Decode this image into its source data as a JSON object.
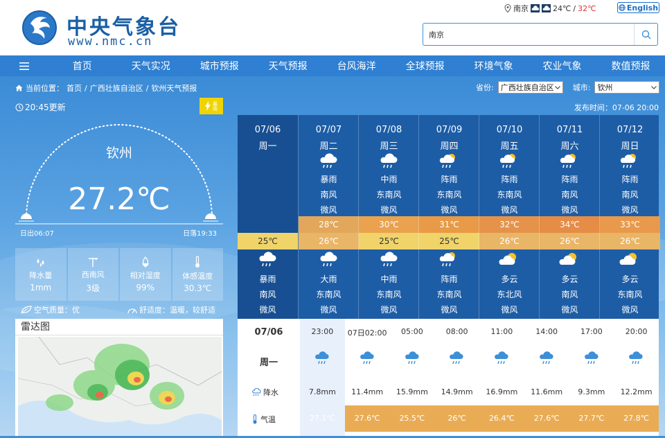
{
  "header": {
    "site_name": "中央气象台",
    "site_url": "www.nmc.cn",
    "location": "南京",
    "temp_low": "24℃",
    "temp_sep": "/",
    "temp_high": "32℃",
    "lang_button": "English",
    "search_value": "南京"
  },
  "nav": {
    "items": [
      "首页",
      "天气实况",
      "城市预报",
      "天气预报",
      "台风海洋",
      "全球预报",
      "环境气象",
      "农业气象",
      "数值预报"
    ]
  },
  "breadcrumb": {
    "prefix": "当前位置：",
    "home": "首页",
    "sep1": "/",
    "region": "广西壮族自治区",
    "sep2": "/",
    "page": "钦州天气预报"
  },
  "selector": {
    "province_label": "省份:",
    "province_value": "广西壮族自治区",
    "city_label": "城市:",
    "city_value": "钦州"
  },
  "current": {
    "update_time": "20:45更新",
    "warning_text": "暴雨",
    "city": "钦州",
    "temperature": "27.2℃",
    "sunrise": "日出06:07",
    "sunset": "日落19:33",
    "publish_time": "发布时间：07-06 20:00",
    "stats": [
      {
        "label": "降水量",
        "value": "1mm",
        "icon": "raindrops-icon"
      },
      {
        "label": "西南风",
        "value": "3级",
        "icon": "wind-icon"
      },
      {
        "label": "相对湿度",
        "value": "99%",
        "icon": "humidity-icon"
      },
      {
        "label": "体感温度",
        "value": "30.3℃",
        "icon": "thermometer-icon"
      }
    ],
    "air_quality": "空气质量：优",
    "comfort": "舒适度：温暖，较舒适"
  },
  "radar": {
    "title": "雷达图"
  },
  "forecast": [
    {
      "date": "07/06",
      "weekday": "周一",
      "day_weather": "",
      "day_wind_dir": "",
      "day_wind": "",
      "high": "",
      "low": "25℃",
      "night_weather": "暴雨",
      "night_wind_dir": "南风",
      "night_wind": "微风",
      "day_icon": "",
      "night_icon": "rain-cloud-icon"
    },
    {
      "date": "07/07",
      "weekday": "周二",
      "day_weather": "暴雨",
      "day_wind_dir": "南风",
      "day_wind": "微风",
      "high": "28℃",
      "low": "26℃",
      "night_weather": "大雨",
      "night_wind_dir": "东南风",
      "night_wind": "微风",
      "day_icon": "rain-cloud-icon",
      "night_icon": "rain-cloud-icon"
    },
    {
      "date": "07/08",
      "weekday": "周三",
      "day_weather": "中雨",
      "day_wind_dir": "东南风",
      "day_wind": "微风",
      "high": "30℃",
      "low": "25℃",
      "night_weather": "中雨",
      "night_wind_dir": "东南风",
      "night_wind": "微风",
      "day_icon": "rain-cloud-icon",
      "night_icon": "rain-cloud-icon"
    },
    {
      "date": "07/09",
      "weekday": "周四",
      "day_weather": "阵雨",
      "day_wind_dir": "东南风",
      "day_wind": "微风",
      "high": "31℃",
      "low": "25℃",
      "night_weather": "阵雨",
      "night_wind_dir": "东南风",
      "night_wind": "微风",
      "day_icon": "sun-shower-icon",
      "night_icon": "sun-shower-icon"
    },
    {
      "date": "07/10",
      "weekday": "周五",
      "day_weather": "阵雨",
      "day_wind_dir": "东南风",
      "day_wind": "微风",
      "high": "32℃",
      "low": "26℃",
      "night_weather": "多云",
      "night_wind_dir": "东北风",
      "night_wind": "微风",
      "day_icon": "sun-shower-icon",
      "night_icon": "partly-cloudy-icon"
    },
    {
      "date": "07/11",
      "weekday": "周六",
      "day_weather": "阵雨",
      "day_wind_dir": "南风",
      "day_wind": "微风",
      "high": "34℃",
      "low": "26℃",
      "night_weather": "多云",
      "night_wind_dir": "南风",
      "night_wind": "微风",
      "day_icon": "sun-shower-icon",
      "night_icon": "partly-cloudy-icon"
    },
    {
      "date": "07/12",
      "weekday": "周日",
      "day_weather": "阵雨",
      "day_wind_dir": "南风",
      "day_wind": "微风",
      "high": "33℃",
      "low": "26℃",
      "night_weather": "多云",
      "night_wind_dir": "东南风",
      "night_wind": "微风",
      "day_icon": "sun-shower-icon",
      "night_icon": "partly-cloudy-icon"
    }
  ],
  "hourly": {
    "date": "07/06",
    "weekday": "周一",
    "precip_label": "降水",
    "temp_label": "气温",
    "slots": [
      {
        "time": "23:00",
        "precip": "7.8mm",
        "temp": "27.1℃"
      },
      {
        "time": "07日02:00",
        "precip": "11.4mm",
        "temp": "27.6℃"
      },
      {
        "time": "05:00",
        "precip": "15.9mm",
        "temp": "25.5℃"
      },
      {
        "time": "08:00",
        "precip": "14.9mm",
        "temp": "26℃"
      },
      {
        "time": "11:00",
        "precip": "16.9mm",
        "temp": "26.4℃"
      },
      {
        "time": "14:00",
        "precip": "11.6mm",
        "temp": "27.6℃"
      },
      {
        "time": "17:00",
        "precip": "9.3mm",
        "temp": "27.7℃"
      },
      {
        "time": "20:00",
        "precip": "12.2mm",
        "temp": "27.8℃"
      }
    ]
  }
}
